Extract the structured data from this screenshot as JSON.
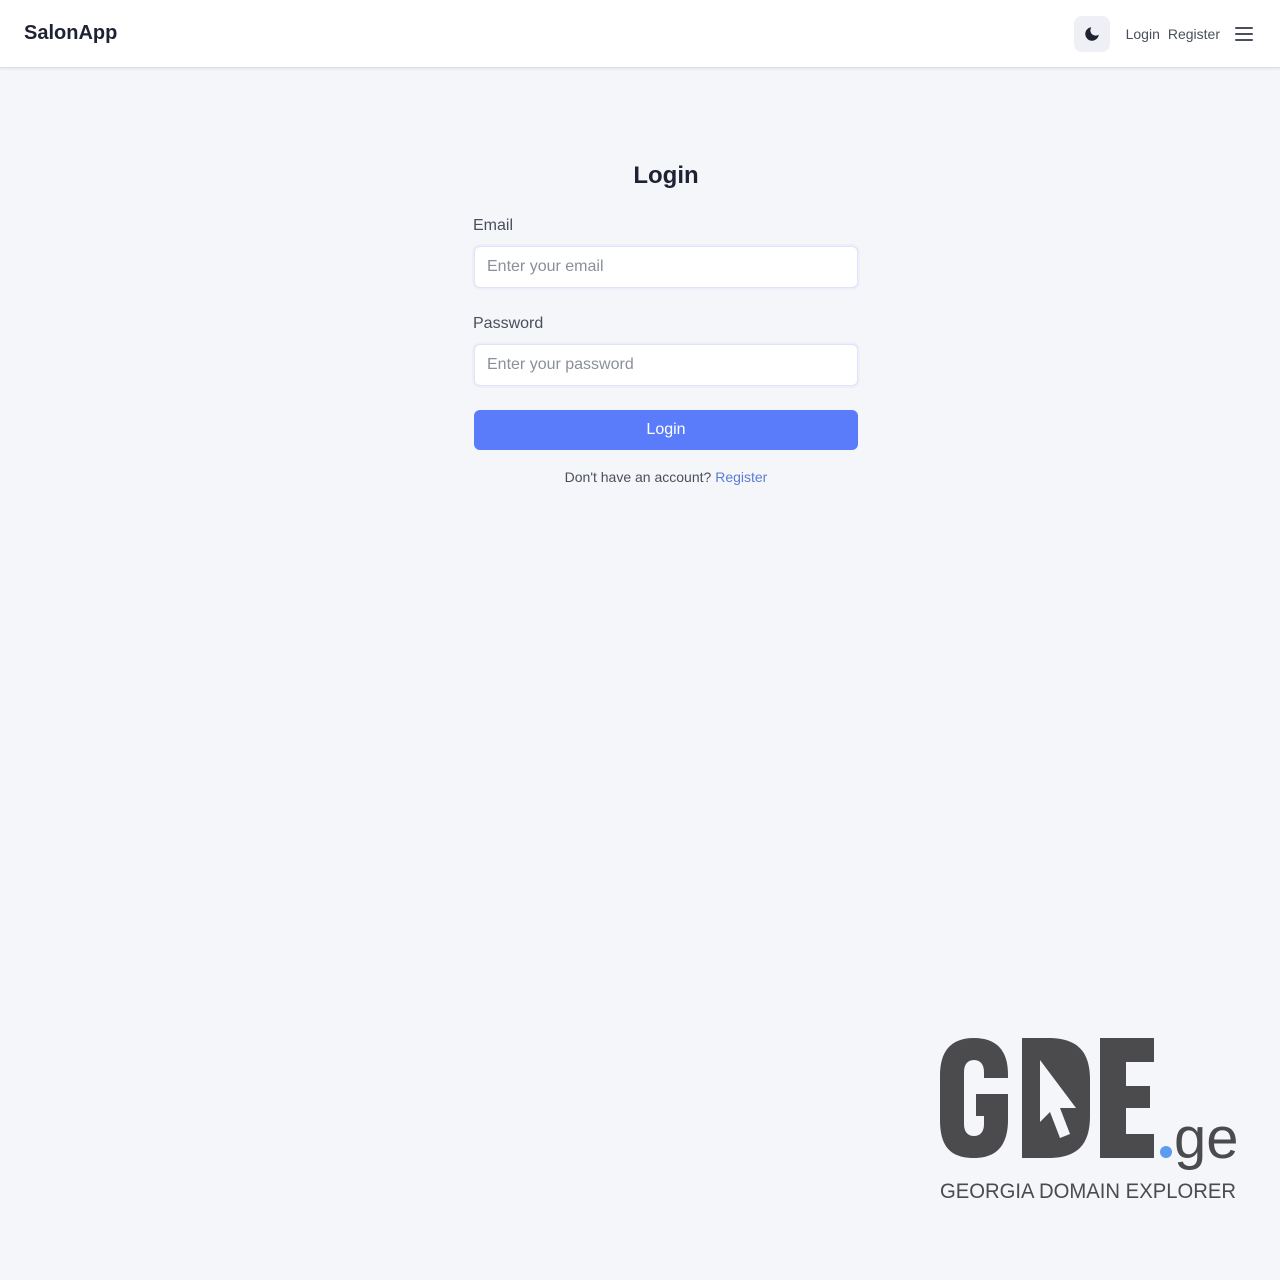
{
  "navbar": {
    "brand": "SalonApp",
    "theme_icon": "moon-icon",
    "login_link": "Login",
    "register_link": "Register",
    "menu_icon": "hamburger-menu-icon"
  },
  "login_form": {
    "title": "Login",
    "email_label": "Email",
    "email_placeholder": "Enter your email",
    "email_value": "",
    "password_label": "Password",
    "password_placeholder": "Enter your password",
    "password_value": "",
    "submit_label": "Login",
    "no_account_text": "Don't have an account?",
    "register_link": "Register"
  },
  "watermark": {
    "logo_text": "GDE.ge",
    "tagline": "GEORGIA DOMAIN EXPLORER"
  },
  "colors": {
    "accent": "#5a7cfa",
    "link": "#5a7cd6",
    "background": "#f5f6fa",
    "logo_dark": "#4b4b4d",
    "logo_dot": "#5b9cf0"
  }
}
